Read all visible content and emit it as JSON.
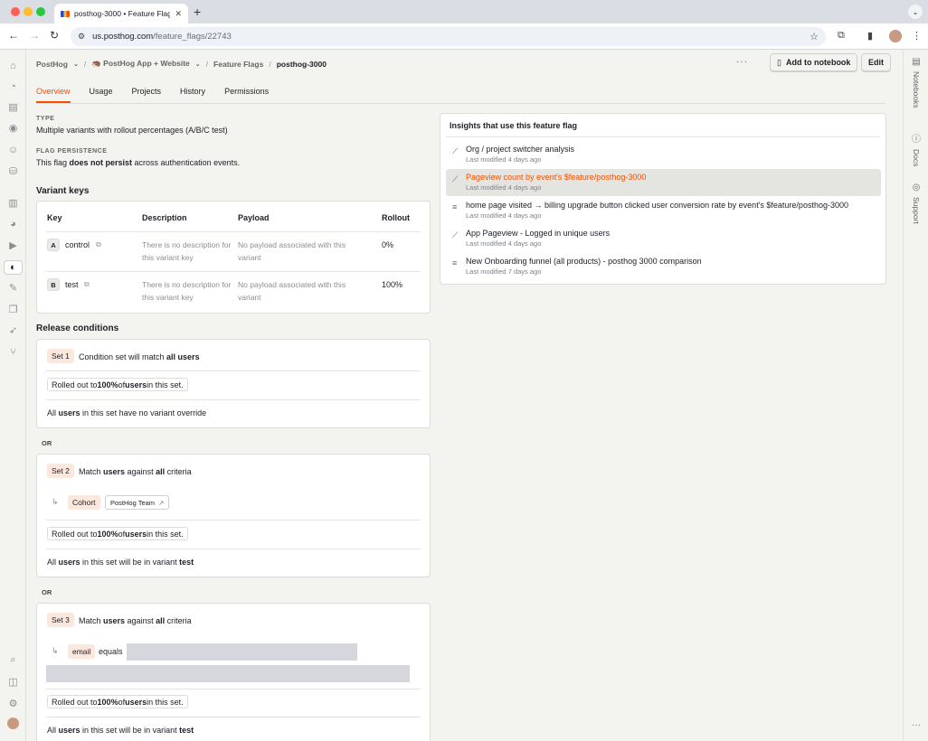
{
  "browser": {
    "tab_title": "posthog-3000 • Feature Flag",
    "url_host": "us.posthog.com",
    "url_path": "/feature_flags/22743"
  },
  "breadcrumb": {
    "org": "PostHog",
    "project": "🦔 PostHog App + Website",
    "section": "Feature Flags",
    "current": "posthog-3000"
  },
  "header": {
    "more": "···",
    "add_to_notebook": "Add to notebook",
    "edit": "Edit"
  },
  "tabs": [
    "Overview",
    "Usage",
    "Projects",
    "History",
    "Permissions"
  ],
  "type": {
    "label": "TYPE",
    "value": "Multiple variants with rollout percentages (A/B/C test)"
  },
  "persistence": {
    "label": "FLAG PERSISTENCE",
    "pre": "This flag ",
    "bold": "does not persist",
    "post": " across authentication events."
  },
  "variant_keys": {
    "title": "Variant keys",
    "columns": [
      "Key",
      "Description",
      "Payload",
      "Rollout"
    ],
    "rows": [
      {
        "badge": "A",
        "key": "control",
        "description": "There is no description for this variant key",
        "payload": "No payload associated with this variant",
        "rollout": "0%"
      },
      {
        "badge": "B",
        "key": "test",
        "description": "There is no description for this variant key",
        "payload": "No payload associated with this variant",
        "rollout": "100%"
      }
    ]
  },
  "release": {
    "title": "Release conditions",
    "or_label": "OR",
    "sets": [
      {
        "badge": "Set 1",
        "title_pre": "Condition set will match ",
        "title_bold": "all users",
        "rollout_pre": "Rolled out to ",
        "rollout_bold": "100%",
        "rollout_mid": " of ",
        "rollout_bold2": "users",
        "rollout_post": " in this set.",
        "foot_pre": "All ",
        "foot_bold": "users",
        "foot_post": " in this set have no variant override"
      },
      {
        "badge": "Set 2",
        "title_pre": "Match ",
        "title_bold": "users",
        "title_mid": " against ",
        "title_bold2": "all",
        "title_post": " criteria",
        "cond_property": "Cohort",
        "cond_value": "PostHog Team",
        "rollout_pre": "Rolled out to ",
        "rollout_bold": "100%",
        "rollout_mid": " of ",
        "rollout_bold2": "users",
        "rollout_post": " in this set.",
        "foot_pre": "All ",
        "foot_bold": "users",
        "foot_mid": " in this set will be in variant ",
        "foot_bold2": "test"
      },
      {
        "badge": "Set 3",
        "title_pre": "Match ",
        "title_bold": "users",
        "title_mid": " against ",
        "title_bold2": "all",
        "title_post": " criteria",
        "cond_property": "email",
        "cond_operator": "equals",
        "rollout_pre": "Rolled out to ",
        "rollout_bold": "100%",
        "rollout_mid": " of ",
        "rollout_bold2": "users",
        "rollout_post": " in this set.",
        "foot_pre": "All ",
        "foot_bold": "users",
        "foot_mid": " in this set will be in variant ",
        "foot_bold2": "test"
      }
    ]
  },
  "insights": {
    "title": "Insights that use this feature flag",
    "items": [
      {
        "icon": "trends-icon",
        "name": "Org / project switcher analysis",
        "modified": "Last modified 4 days ago"
      },
      {
        "icon": "trends-icon",
        "name": "Pageview count by event's $feature/posthog-3000",
        "modified": "Last modified 4 days ago",
        "highlighted": true
      },
      {
        "icon": "funnel-icon",
        "name": "home page visited → billing upgrade button clicked user conversion rate by event's $feature/posthog-3000",
        "modified": "Last modified 4 days ago"
      },
      {
        "icon": "trends-icon",
        "name": "App Pageview - Logged in unique users",
        "modified": "Last modified 4 days ago"
      },
      {
        "icon": "funnel-icon",
        "name": "New Onboarding funnel (all products) - posthog 3000 comparison",
        "modified": "Last modified 7 days ago"
      }
    ]
  },
  "right_sidebar": {
    "notebooks": "Notebooks",
    "docs": "Docs",
    "support": "Support"
  },
  "colors": {
    "accent": "#f54e00",
    "background": "#f3f4ef"
  }
}
